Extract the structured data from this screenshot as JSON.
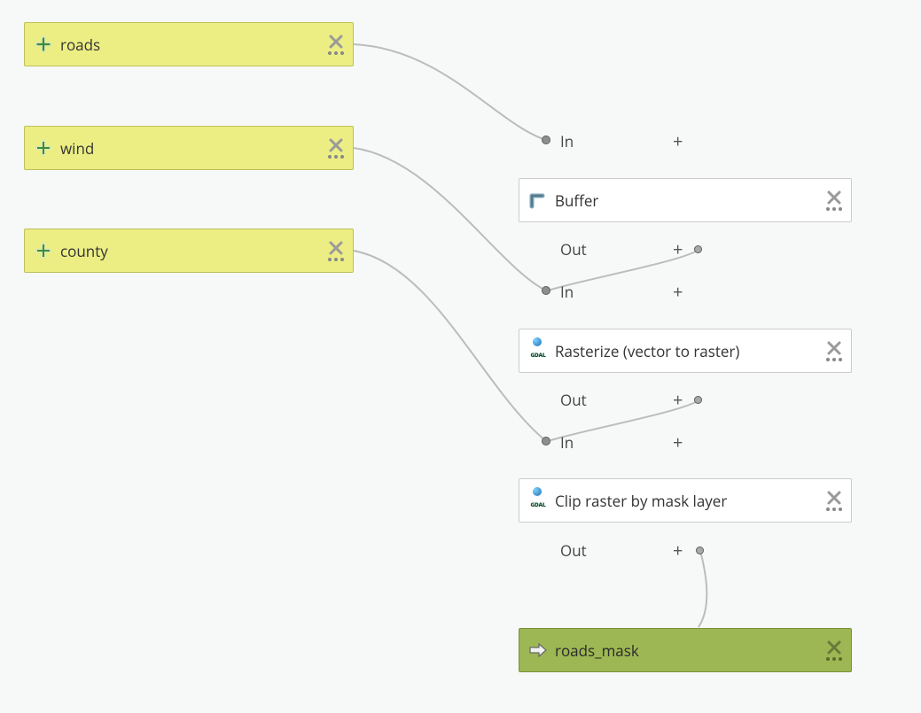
{
  "inputs": {
    "roads": {
      "label": "roads"
    },
    "wind": {
      "label": "wind"
    },
    "county": {
      "label": "county"
    }
  },
  "algorithms": {
    "buffer": {
      "label": "Buffer",
      "in_label": "In",
      "out_label": "Out"
    },
    "rasterize": {
      "label": "Rasterize (vector to raster)",
      "in_label": "In",
      "out_label": "Out"
    },
    "clip": {
      "label": "Clip raster by mask layer",
      "in_label": "In",
      "out_label": "Out"
    }
  },
  "outputs": {
    "roads_mask": {
      "label": "roads_mask"
    }
  },
  "glyphs": {
    "plus": "+"
  },
  "icons": {
    "plus": "plus-icon",
    "arrow": "arrow-icon",
    "close": "close-icon",
    "more": "more-icon",
    "buffer": "buffer-icon",
    "gdal": "gdal-icon"
  }
}
